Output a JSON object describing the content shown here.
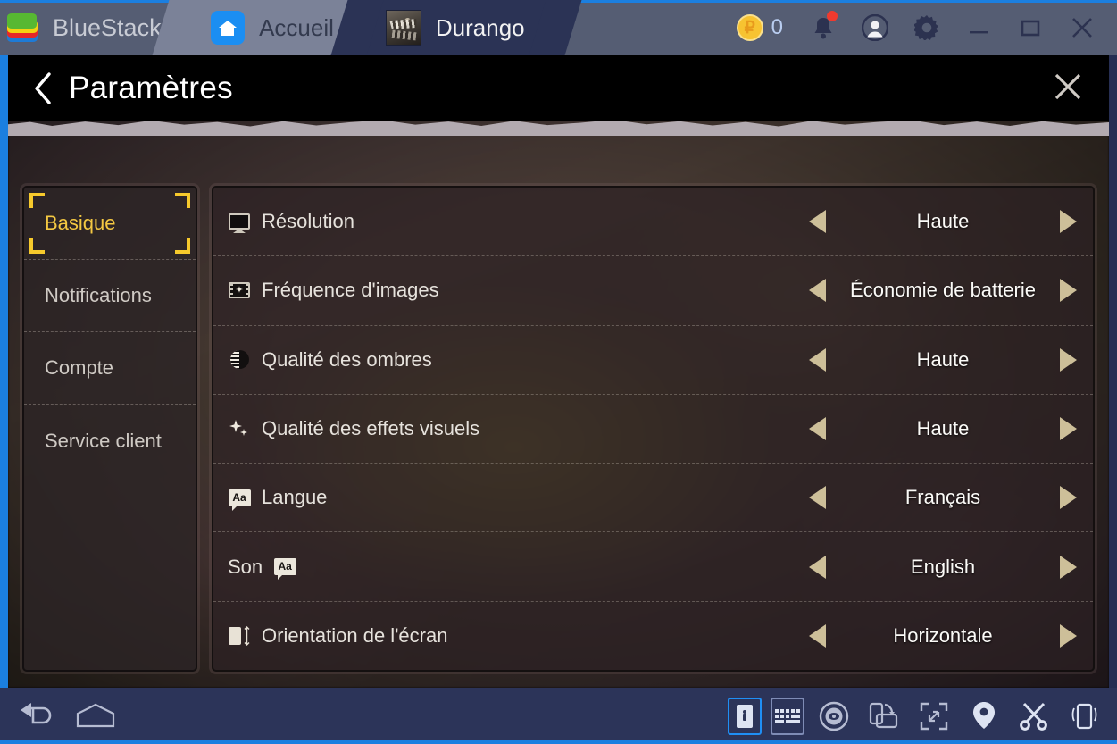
{
  "titlebar": {
    "brand": "BlueStacks",
    "tabs": [
      {
        "label": "Accueil",
        "icon": "home-icon"
      },
      {
        "label": "Durango",
        "icon": "game-thumbnail"
      }
    ],
    "points": {
      "icon": "coin-icon",
      "value": "0"
    },
    "icons": {
      "notifications": "bell-icon",
      "account": "account-icon",
      "settings": "gear-icon",
      "minimize": "minimize-icon",
      "maximize": "maximize-icon",
      "close": "close-icon"
    }
  },
  "settings": {
    "back_icon": "chevron-left-icon",
    "title": "Paramètres",
    "close_icon": "close-icon",
    "sidebar": [
      {
        "label": "Basique",
        "active": true
      },
      {
        "label": "Notifications",
        "active": false
      },
      {
        "label": "Compte",
        "active": false
      },
      {
        "label": "Service client",
        "active": false
      }
    ],
    "options": [
      {
        "icon": "monitor-icon",
        "label": "Résolution",
        "value": "Haute"
      },
      {
        "icon": "film-strip-icon",
        "label": "Fréquence d'images",
        "value": "Économie de batterie"
      },
      {
        "icon": "shadow-icon",
        "label": "Qualité des ombres",
        "value": "Haute"
      },
      {
        "icon": "sparkle-icon",
        "label": "Qualité des effets visuels",
        "value": "Haute"
      },
      {
        "icon": "language-aa-icon",
        "label": "Langue",
        "value": "Français"
      },
      {
        "icon": "language-aa-icon",
        "label": "Son",
        "value": "English",
        "icon_after": true
      },
      {
        "icon": "orientation-icon",
        "label": "Orientation de l'écran",
        "value": "Horizontale"
      }
    ],
    "arrow_left_icon": "arrow-left-icon",
    "arrow_right_icon": "arrow-right-icon"
  },
  "bottombar": {
    "left": [
      {
        "icon": "back-arrow-icon"
      },
      {
        "icon": "home-pentagon-icon"
      }
    ],
    "right": [
      {
        "icon": "game-controls-icon",
        "active": true
      },
      {
        "icon": "keyboard-icon",
        "active": false
      },
      {
        "icon": "macro-recorder-icon",
        "active": false
      },
      {
        "icon": "rotate-screen-icon",
        "active": false
      },
      {
        "icon": "fullscreen-icon",
        "active": false
      },
      {
        "icon": "location-icon",
        "active": false
      },
      {
        "icon": "screenshot-scissors-icon",
        "active": false
      },
      {
        "icon": "shake-phone-icon",
        "active": false
      }
    ]
  },
  "colors": {
    "titlebar_bg": "#555d73",
    "accent_blue": "#1b7fe0",
    "highlight_yellow": "#f6c92c",
    "arrow_tan": "#cdbf99",
    "bottombar_bg": "#2c3459"
  }
}
